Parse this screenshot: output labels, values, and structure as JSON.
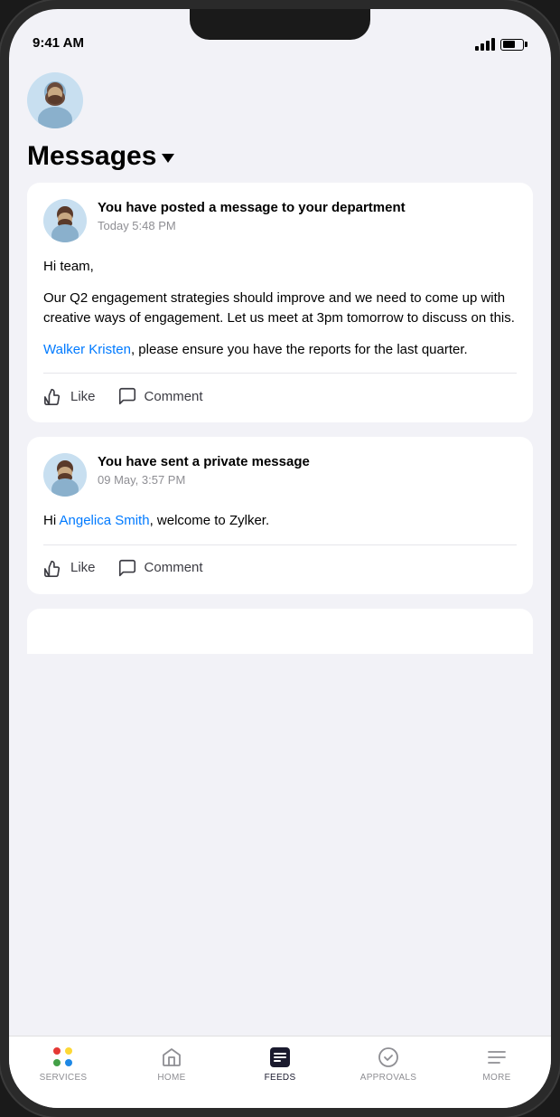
{
  "status_bar": {
    "time": "9:41 AM"
  },
  "header": {
    "title": "Messages",
    "dropdown_label": "Messages dropdown"
  },
  "messages": [
    {
      "id": 1,
      "title": "You have posted a message to your department",
      "time": "Today 5:48 PM",
      "body_paragraph1": "Hi team,",
      "body_paragraph2": "Our Q2 engagement strategies should improve and we need to come up with creative ways of engagement. Let us meet at 3pm tomorrow to discuss on this.",
      "body_paragraph3_pre": "",
      "mention": "Walker Kristen",
      "body_paragraph3_post": ", please ensure you have the reports for the last quarter.",
      "like_label": "Like",
      "comment_label": "Comment"
    },
    {
      "id": 2,
      "title": "You have sent a private message",
      "time": "09 May, 3:57 PM",
      "body_pre": "Hi ",
      "mention": "Angelica Smith",
      "body_post": ", welcome to Zylker.",
      "like_label": "Like",
      "comment_label": "Comment"
    }
  ],
  "tab_bar": {
    "items": [
      {
        "id": "services",
        "label": "SERVICES",
        "active": false
      },
      {
        "id": "home",
        "label": "HOME",
        "active": false
      },
      {
        "id": "feeds",
        "label": "FEEDS",
        "active": true
      },
      {
        "id": "approvals",
        "label": "APPROVALS",
        "active": false
      },
      {
        "id": "more",
        "label": "MORE",
        "active": false
      }
    ]
  }
}
